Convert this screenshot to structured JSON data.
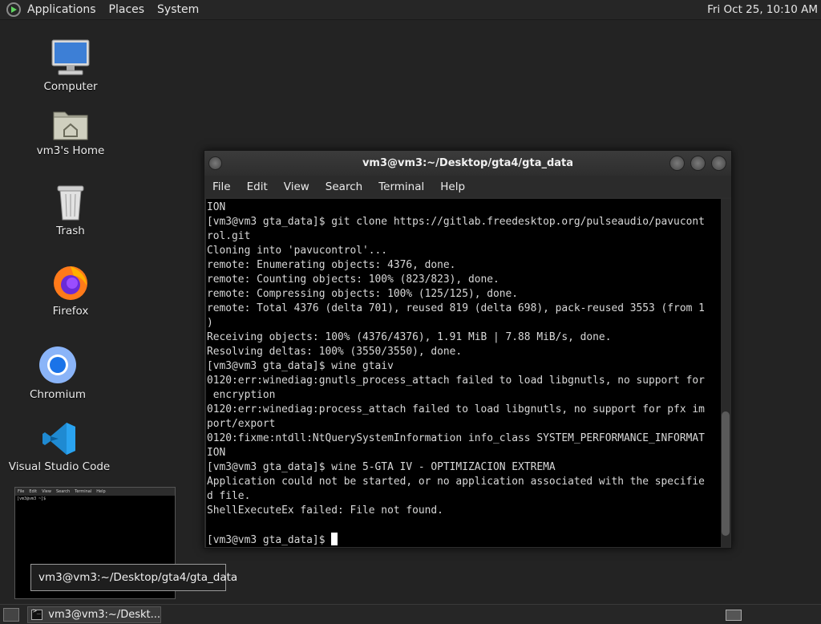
{
  "top_panel": {
    "menus": [
      "Applications",
      "Places",
      "System"
    ],
    "clock": "Fri Oct 25, 10:10 AM"
  },
  "desktop_icons": [
    {
      "label": "Computer",
      "icon": "computer-icon"
    },
    {
      "label": "vm3's Home",
      "icon": "home-folder-icon"
    },
    {
      "label": "Trash",
      "icon": "trash-icon"
    },
    {
      "label": "Firefox",
      "icon": "firefox-icon"
    },
    {
      "label": "Chromium",
      "icon": "chromium-icon"
    },
    {
      "label": "Visual Studio Code",
      "icon": "vscode-icon"
    }
  ],
  "terminal": {
    "title": "vm3@vm3:~/Desktop/gta4/gta_data",
    "menus": [
      "File",
      "Edit",
      "View",
      "Search",
      "Terminal",
      "Help"
    ],
    "lines": [
      "ION",
      "[vm3@vm3 gta_data]$ git clone https://gitlab.freedesktop.org/pulseaudio/pavucont",
      "rol.git",
      "Cloning into 'pavucontrol'...",
      "remote: Enumerating objects: 4376, done.",
      "remote: Counting objects: 100% (823/823), done.",
      "remote: Compressing objects: 100% (125/125), done.",
      "remote: Total 4376 (delta 701), reused 819 (delta 698), pack-reused 3553 (from 1",
      ")",
      "Receiving objects: 100% (4376/4376), 1.91 MiB | 7.88 MiB/s, done.",
      "Resolving deltas: 100% (3550/3550), done.",
      "[vm3@vm3 gta_data]$ wine gtaiv",
      "0120:err:winediag:gnutls_process_attach failed to load libgnutls, no support for",
      " encryption",
      "0120:err:winediag:process_attach failed to load libgnutls, no support for pfx im",
      "port/export",
      "0120:fixme:ntdll:NtQuerySystemInformation info_class SYSTEM_PERFORMANCE_INFORMAT",
      "ION",
      "[vm3@vm3 gta_data]$ wine 5-GTA IV - OPTIMIZACION EXTREMA",
      "Application could not be started, or no application associated with the specifie",
      "d file.",
      "ShellExecuteEx failed: File not found.",
      ""
    ],
    "prompt": "[vm3@vm3 gta_data]$ "
  },
  "preview": {
    "menus": [
      "File",
      "Edit",
      "View",
      "Search",
      "Terminal",
      "Help"
    ],
    "text": "[vm3@vm3 ~]$"
  },
  "tooltip": "vm3@vm3:~/Desktop/gta4/gta_data",
  "taskbar": {
    "task_label": "vm3@vm3:~/Deskt..."
  }
}
